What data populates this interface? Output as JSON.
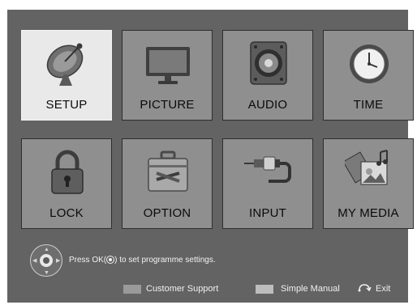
{
  "menu": {
    "items": [
      {
        "label": "SETUP",
        "icon": "satellite-dish-icon",
        "selected": true
      },
      {
        "label": "PICTURE",
        "icon": "tv-monitor-icon",
        "selected": false
      },
      {
        "label": "AUDIO",
        "icon": "speaker-icon",
        "selected": false
      },
      {
        "label": "TIME",
        "icon": "clock-icon",
        "selected": false
      },
      {
        "label": "LOCK",
        "icon": "padlock-icon",
        "selected": false
      },
      {
        "label": "OPTION",
        "icon": "toolbox-icon",
        "selected": false
      },
      {
        "label": "INPUT",
        "icon": "av-cable-icon",
        "selected": false
      },
      {
        "label": "MY MEDIA",
        "icon": "media-photo-music-icon",
        "selected": false
      }
    ]
  },
  "hint": {
    "prefix": "Press OK(",
    "suffix": ") to set programme settings."
  },
  "footer": {
    "customer_support": "Customer Support",
    "simple_manual": "Simple Manual",
    "exit": "Exit"
  },
  "colors": {
    "background": "#636363",
    "tile": "#8f8f8f",
    "tile_selected": "#e9e9e9",
    "customer_support_key": "#9a9a9a",
    "simple_manual_key": "#bdbdbd"
  }
}
